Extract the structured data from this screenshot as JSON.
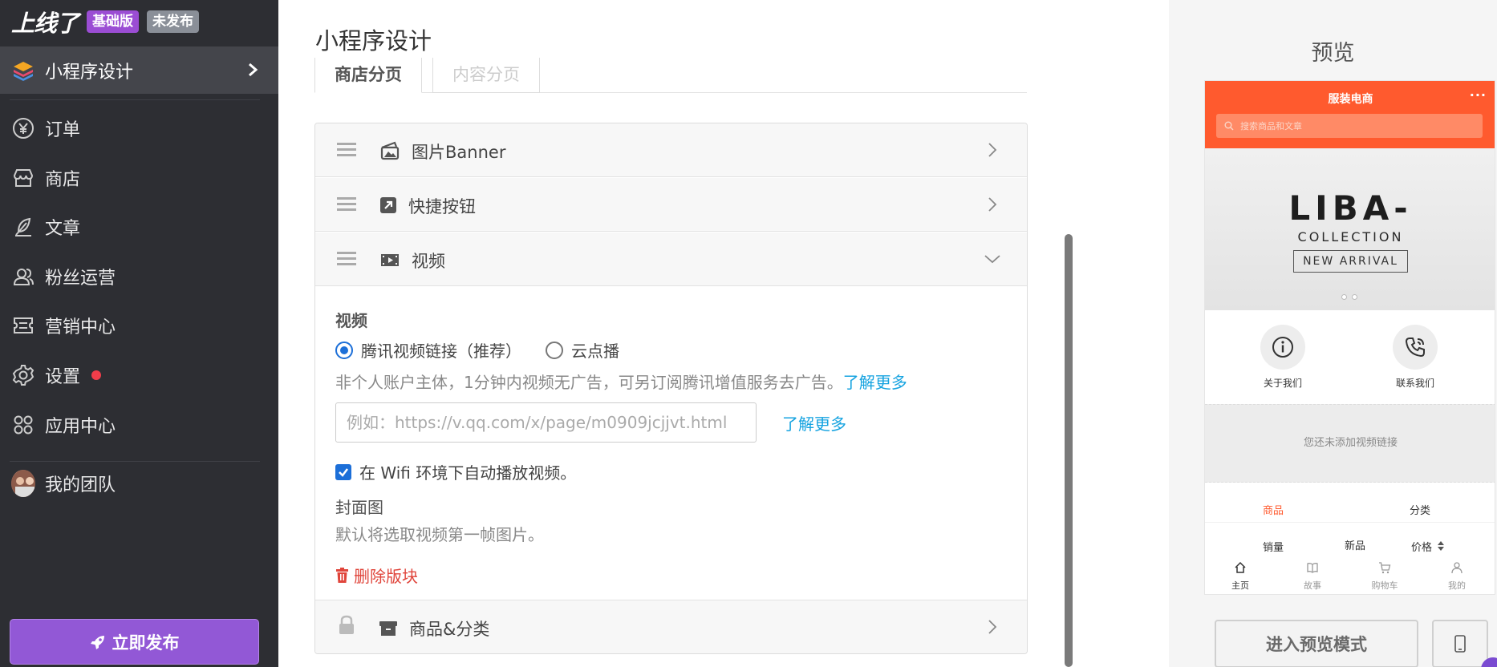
{
  "sidebar": {
    "brand": "上线了",
    "tag_basic": "基础版",
    "tag_unpublished": "未发布",
    "active_item": "小程序设计",
    "items": [
      {
        "label": "订单",
        "icon": "yen-circle-icon"
      },
      {
        "label": "商店",
        "icon": "store-icon"
      },
      {
        "label": "文章",
        "icon": "feather-icon"
      },
      {
        "label": "粉丝运营",
        "icon": "users-icon"
      },
      {
        "label": "营销中心",
        "icon": "ticket-icon"
      },
      {
        "label": "设置",
        "icon": "gear-icon"
      },
      {
        "label": "应用中心",
        "icon": "grid-icon"
      }
    ],
    "team": "我的团队",
    "publish": "立即发布"
  },
  "main": {
    "title": "小程序设计",
    "tabs": [
      "商店分页",
      "内容分页"
    ],
    "blocks": [
      {
        "title": "图片Banner"
      },
      {
        "title": "快捷按钮"
      },
      {
        "title": "视频"
      },
      {
        "title": "商品&分类"
      }
    ],
    "video": {
      "heading": "视频",
      "radio_tencent": "腾讯视频链接（推荐）",
      "radio_vod": "云点播",
      "hint": "非个人账户主体，1分钟内视频无广告，可另订阅腾讯增值服务去广告。",
      "learn_more": "了解更多",
      "url_placeholder": "例如：https://v.qq.com/x/page/m0909jcjjvt.html",
      "autoplay": "在 Wifi 环境下自动播放视频。",
      "cover_label": "封面图",
      "cover_hint": "默认将选取视频第一帧图片。",
      "delete": "删除版块"
    }
  },
  "preview": {
    "title": "预览",
    "app_name": "服装电商",
    "menu_dots": "···",
    "search_placeholder": "搜索商品和文章",
    "banner_line1": "LIBA-",
    "banner_line2": "COLLECTION",
    "banner_line3": "NEW ARRIVAL",
    "quick": [
      "关于我们",
      "联系我们"
    ],
    "video_empty": "您还未添加视频链接",
    "cat_tabs": [
      "商品",
      "分类"
    ],
    "sort": [
      "销量",
      "新品",
      "价格"
    ],
    "tabbar": [
      "主页",
      "故事",
      "购物车",
      "我的"
    ],
    "enter_preview": "进入预览模式"
  },
  "colors": {
    "sidebar_bg": "#2d2e33",
    "accent_purple": "#9258d6",
    "preview_orange": "#ff5a2e",
    "link_blue": "#16a3e0",
    "danger_red": "#e0453b"
  }
}
